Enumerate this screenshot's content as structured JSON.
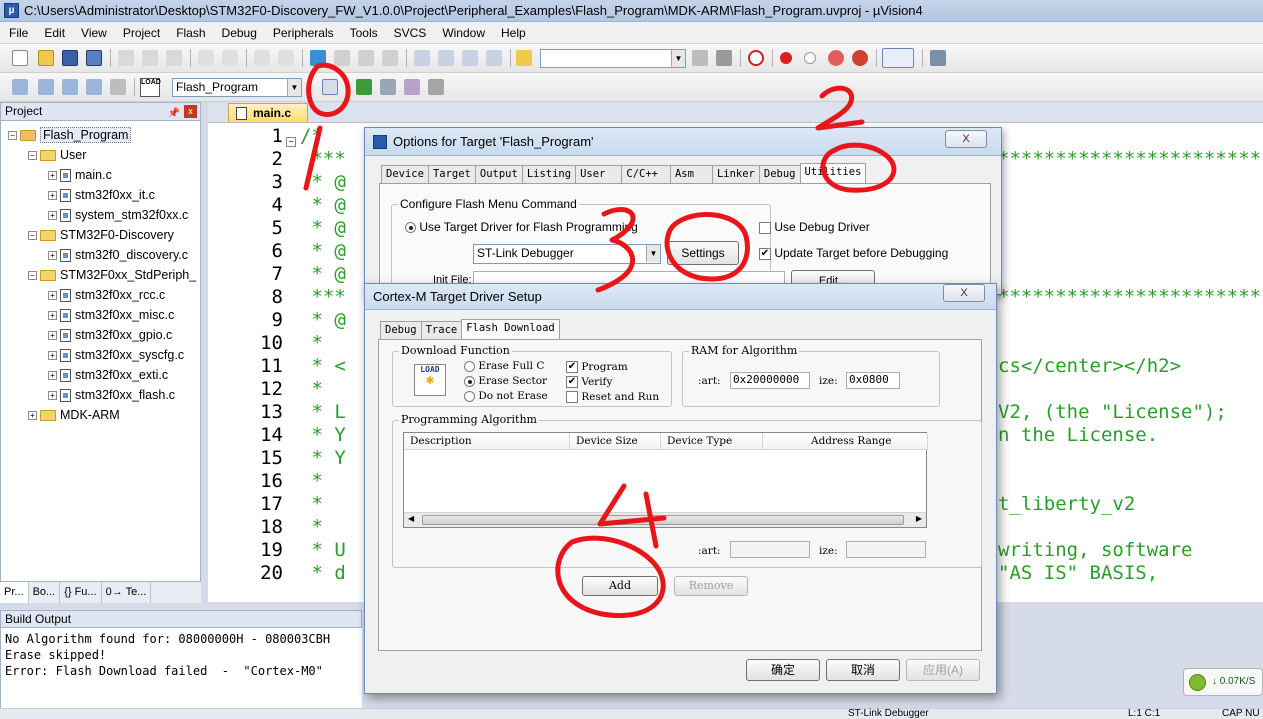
{
  "window": {
    "title": "C:\\Users\\Administrator\\Desktop\\STM32F0-Discovery_FW_V1.0.0\\Project\\Peripheral_Examples\\Flash_Program\\MDK-ARM\\Flash_Program.uvproj - µVision4"
  },
  "menu": [
    "File",
    "Edit",
    "View",
    "Project",
    "Flash",
    "Debug",
    "Peripherals",
    "Tools",
    "SVCS",
    "Window",
    "Help"
  ],
  "toolbar": {
    "target_name": "Flash_Program",
    "load_label": "LOAD",
    "search_value": ""
  },
  "project_panel": {
    "title": "Project",
    "tree": [
      "Flash_Program",
      "User",
      "main.c",
      "stm32f0xx_it.c",
      "system_stm32f0xx.c",
      "STM32F0-Discovery",
      "stm32f0_discovery.c",
      "STM32F0xx_StdPeriph_",
      "stm32f0xx_rcc.c",
      "stm32f0xx_misc.c",
      "stm32f0xx_gpio.c",
      "stm32f0xx_syscfg.c",
      "stm32f0xx_exti.c",
      "stm32f0xx_flash.c",
      "MDK-ARM"
    ],
    "tabs": [
      "Pr...",
      "Bo...",
      "{} Fu...",
      "0→ Te..."
    ]
  },
  "editor": {
    "tab": "main.c",
    "line_numbers": [
      "1",
      "2",
      "3",
      "4",
      "5",
      "6",
      "7",
      "8",
      "9",
      "10",
      "11",
      "12",
      "13",
      "14",
      "15",
      "16",
      "17",
      "18",
      "19",
      "20"
    ],
    "code_left": [
      "/*",
      " ***",
      " * @",
      " * @",
      " * @",
      " * @",
      " * @",
      " ***",
      " * @",
      " *",
      " * <",
      " *",
      " * L",
      " * Y",
      " * Y",
      " *",
      " *",
      " *",
      " * U",
      " * d"
    ],
    "code_right": {
      "l2": "***********************",
      "l8": "***********************",
      "l11": "cs</center></h2>",
      "l13": "V2, (the \"License\");",
      "l14": "n the License.",
      "l17": "t_liberty_v2",
      "l19": "writing, software",
      "l20": "\"AS IS\" BASIS,"
    }
  },
  "build_output": {
    "title": "Build Output",
    "lines": [
      "No Algorithm found for: 08000000H - 080003CBH",
      "Erase skipped!",
      "Error: Flash Download failed  -  \"Cortex-M0\""
    ]
  },
  "status_bar": {
    "debugger": "ST-Link Debugger",
    "position": "L:1 C:1",
    "caps": "CAP NU"
  },
  "tray": {
    "speed": "↓ 0.07K/S"
  },
  "options_dialog": {
    "title": "Options for Target 'Flash_Program'",
    "close_label": "X",
    "tabs": [
      "Device",
      "Target",
      "Output",
      "Listing",
      "User",
      "C/C++",
      "Asm",
      "Linker",
      "Debug",
      "Utilities"
    ],
    "active_tab": "Utilities",
    "group_label": "Configure Flash Menu Command",
    "use_target_driver": "Use Target Driver for Flash Programming",
    "use_debug_driver": "Use Debug Driver",
    "driver_select": "ST-Link Debugger",
    "settings_button": "Settings",
    "update_target": "Update Target before Debugging",
    "init_file_label": "Init File:",
    "edit_button": "Edit..."
  },
  "cortex_dialog": {
    "title": "Cortex-M Target Driver Setup",
    "tabs": [
      "Debug",
      "Trace",
      "Flash Download"
    ],
    "active_tab": "Flash Download",
    "download_function": {
      "label": "Download Function",
      "load_icon_text": "LOAD",
      "erase_full": "Erase Full C",
      "erase_sectors": "Erase Sector",
      "do_not_erase": "Do not Erase",
      "program": "Program",
      "verify": "Verify",
      "reset_run": "Reset and Run"
    },
    "ram_for_algorithm": {
      "label": "RAM for Algorithm",
      "start_label": ":art:",
      "start_value": "0x20000000",
      "size_label": "ize:",
      "size_value": "0x0800"
    },
    "programming_algorithm": {
      "label": "Programming Algorithm",
      "columns": [
        "Description",
        "Device Size",
        "Device Type",
        "Address Range"
      ],
      "start_label": ":art:",
      "size_label": "ize:"
    },
    "add_button": "Add",
    "remove_button": "Remove",
    "ok_button": "确定",
    "cancel_button": "取消",
    "apply_button": "应用(A)"
  },
  "annotations": [
    "1",
    "2",
    "3",
    "4"
  ],
  "colors": {
    "annotation": "#e8151b",
    "code_comment": "#2a9d2a",
    "title_bar": "#c4d3e8"
  }
}
